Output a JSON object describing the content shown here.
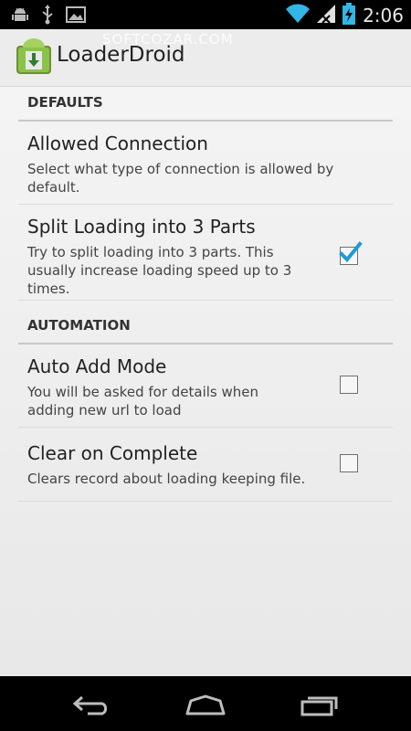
{
  "status_bar": {
    "time": "2:06",
    "icons": [
      "android-debug-icon",
      "usb-icon",
      "image-notification-icon",
      "wifi-icon",
      "signal-icon",
      "battery-charging-icon"
    ]
  },
  "action_bar": {
    "title": "LoaderDroid",
    "watermark": "SOFTCOZAR.COM",
    "icon": "loaderdroid-app-icon"
  },
  "settings": {
    "defaults_header": "DEFAULTS",
    "allowed_connection": {
      "title": "Allowed Connection",
      "summary": "Select what type of connection is allowed by default."
    },
    "split_loading": {
      "title": "Split Loading into 3 Parts",
      "summary": "Try to split loading into 3 parts. This usually increase loading speed up to 3 times.",
      "checked": true
    },
    "automation_header": "AUTOMATION",
    "auto_add_mode": {
      "title": "Auto Add Mode",
      "summary": "You will be asked for details when adding new url to load",
      "checked": false
    },
    "clear_on_complete": {
      "title": "Clear on Complete",
      "summary": "Clears record about loading keeping file.",
      "checked": false
    }
  },
  "nav_bar": {
    "icons": [
      "back-icon",
      "home-icon",
      "recent-apps-icon"
    ]
  },
  "colors": {
    "accent": "#33b5e5",
    "check": "#1f9ad6",
    "app_icon_green": "#7cb342"
  }
}
